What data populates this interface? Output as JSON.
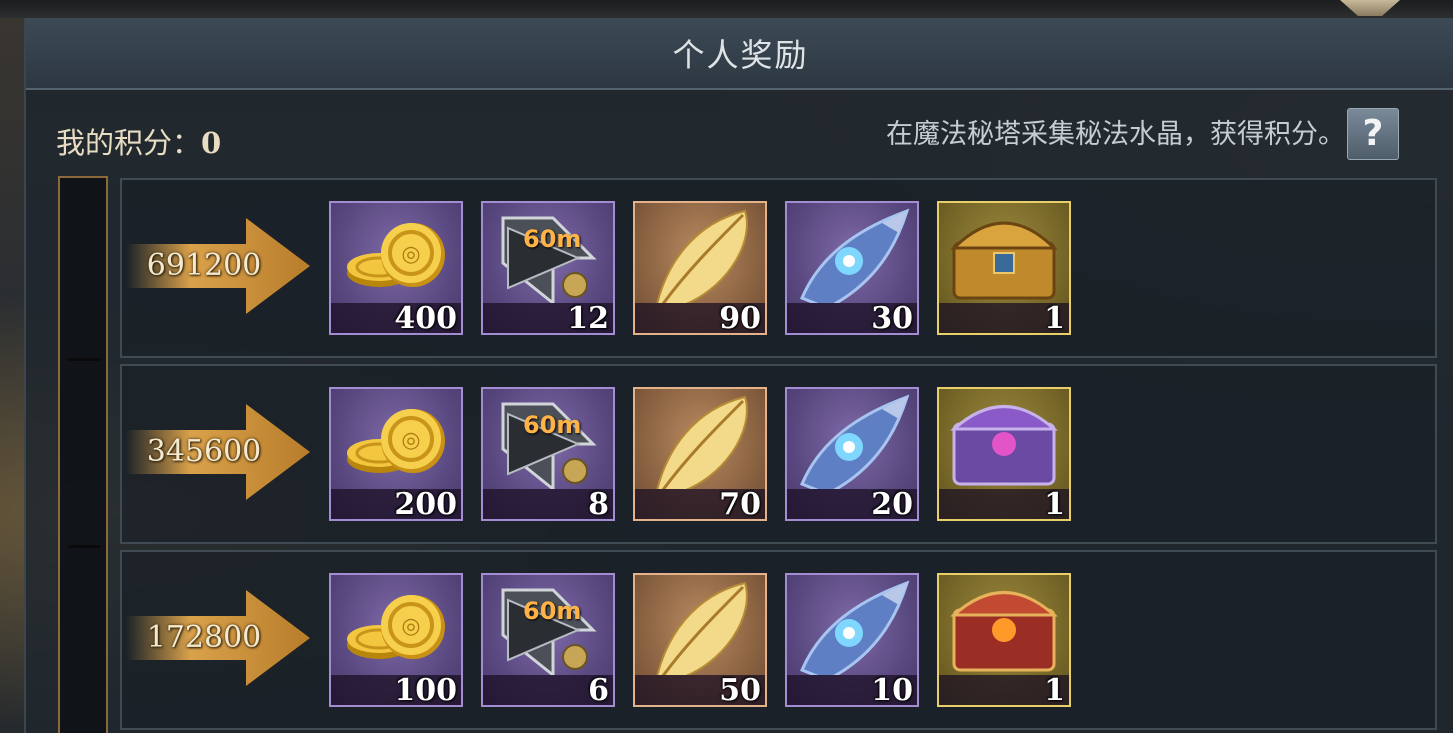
{
  "title": "个人奖励",
  "score": {
    "label": "我的积分：",
    "value": "0"
  },
  "hint": "在魔法秘塔采集秘法水晶，获得积分。",
  "help_label": "?",
  "colors": {
    "arrow": "#d9a14a",
    "purple_frame": "#a48cd2",
    "orange_frame": "#e3b28a",
    "gold_frame": "#e8cf6a"
  },
  "tiers": [
    {
      "points": "691200",
      "rewards": [
        {
          "icon": "gold-coins-icon",
          "qty": "400"
        },
        {
          "icon": "speedup-60m-icon",
          "badge": "60m",
          "qty": "12"
        },
        {
          "icon": "golden-feather-icon",
          "qty": "90"
        },
        {
          "icon": "crystal-horn-icon",
          "qty": "30"
        },
        {
          "icon": "golden-chest-icon",
          "qty": "1"
        }
      ]
    },
    {
      "points": "345600",
      "rewards": [
        {
          "icon": "gold-coins-icon",
          "qty": "200"
        },
        {
          "icon": "speedup-60m-icon",
          "badge": "60m",
          "qty": "8"
        },
        {
          "icon": "golden-feather-icon",
          "qty": "70"
        },
        {
          "icon": "crystal-horn-icon",
          "qty": "20"
        },
        {
          "icon": "purple-chest-icon",
          "qty": "1"
        }
      ]
    },
    {
      "points": "172800",
      "rewards": [
        {
          "icon": "gold-coins-icon",
          "qty": "100"
        },
        {
          "icon": "speedup-60m-icon",
          "badge": "60m",
          "qty": "6"
        },
        {
          "icon": "golden-feather-icon",
          "qty": "50"
        },
        {
          "icon": "crystal-horn-icon",
          "qty": "10"
        },
        {
          "icon": "red-chest-icon",
          "qty": "1"
        }
      ]
    }
  ]
}
